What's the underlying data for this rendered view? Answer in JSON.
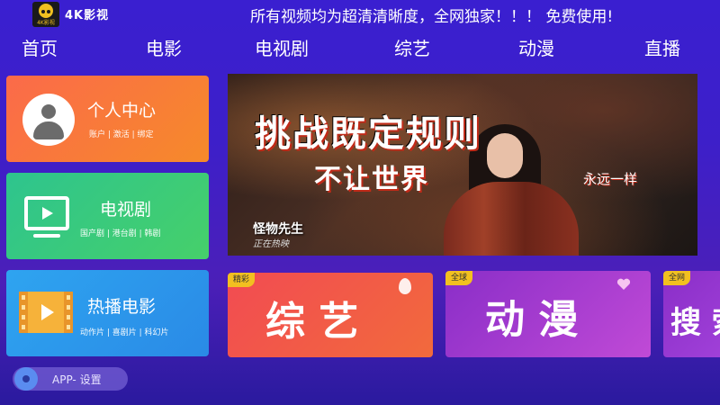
{
  "header": {
    "logo_text": "4K影视",
    "app_title": "4K影视",
    "marquee": "所有视频均为超清清晰度，全网独家！！！    免费使用!"
  },
  "nav": {
    "items": [
      {
        "label": "首页"
      },
      {
        "label": "电影"
      },
      {
        "label": "电视剧"
      },
      {
        "label": "综艺"
      },
      {
        "label": "动漫"
      },
      {
        "label": "直播"
      }
    ]
  },
  "tiles": {
    "user": {
      "label": "个人中心",
      "sub": "账户 | 激活 | 绑定"
    },
    "tv": {
      "label": "电视剧",
      "sub": "国产剧 | 港台剧 | 韩剧"
    },
    "movie": {
      "label": "热播电影",
      "sub": "动作片 | 喜剧片 | 科幻片"
    }
  },
  "banner": {
    "title_line1": "挑战既定规则",
    "title_line2": "不让世界",
    "slogan": "永远一样",
    "show_name": "怪物先生",
    "status": "正在热映"
  },
  "categories": {
    "variety": {
      "tag": "精彩",
      "label": "综 艺"
    },
    "anime": {
      "tag": "全球",
      "label": "动 漫"
    },
    "search": {
      "tag": "全网",
      "label": "搜 索"
    }
  },
  "footer": {
    "settings_label": "APP- 设置"
  },
  "colors": {
    "background": "#3a1fd0",
    "user_tile": "#fb6a4a",
    "tv_tile": "#2ec48e",
    "movie_tile": "#2ea4f0",
    "variety_tile": "#f24b52",
    "anime_tile": "#8a2ec8",
    "tag": "#f2c020"
  }
}
